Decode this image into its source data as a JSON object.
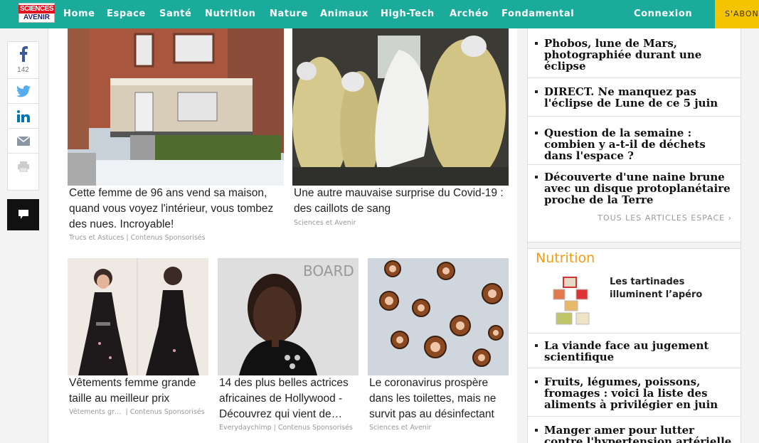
{
  "header": {
    "logo_line1": "SCIENCES",
    "logo_line2": "AVENIR",
    "nav": [
      "Home",
      "Espace",
      "Santé",
      "Nutrition",
      "Nature",
      "Animaux",
      "High-Tech",
      "Archéo",
      "Fondamental"
    ],
    "login": "Connexion",
    "subscribe": "S'ABONNER"
  },
  "share": {
    "facebook_count": "142",
    "icons": [
      "facebook-icon",
      "twitter-icon",
      "linkedin-icon",
      "email-icon",
      "print-icon"
    ],
    "comment_icon": "comment-icon"
  },
  "cards": [
    {
      "title": "Cette femme de 96 ans vend sa maison, quand vous voyez l'intérieur, vous tombez des nues. Incroyable!",
      "source": "Trucs et Astuces",
      "sponsored": "Contenus Sponsorisés"
    },
    {
      "title": "Une autre mauvaise surprise du Covid-19 : des caillots de sang",
      "source": "Sciences et Avenir",
      "sponsored": ""
    },
    {
      "title": "Vêtements femme grande taille au meilleur prix",
      "source": "Vêtements gr…",
      "sponsored": "Contenus Sponsorisés"
    },
    {
      "title": "14 des plus belles actrices africaines de Hollywood - Découvrez qui vient de…",
      "source": "Everydaychimp",
      "sponsored": "Contenus Sponsorisés"
    },
    {
      "title": "Le coronavirus prospère dans les toilettes, mais ne survit pas au désinfectant",
      "source": "Sciences et Avenir",
      "sponsored": ""
    }
  ],
  "sidebar": {
    "espace_articles": [
      "Phobos, lune de Mars, photographiée durant une éclipse",
      "DIRECT. Ne manquez pas l'éclipse de Lune de ce 5 juin",
      "Question de la semaine : combien y a-t-il de déchets dans l'espace ?",
      "Découverte d'une naine brune avec un disque protoplanétaire proche de la Terre"
    ],
    "all_espace": "TOUS LES ARTICLES ESPACE",
    "nutrition_heading": "Nutrition",
    "nutrition_feature": "Les tartinades illuminent l’apéro",
    "nutrition_articles": [
      "La viande face au jugement scientifique",
      "Fruits, légumes, poissons, fromages : voici la liste des aliments à privilégier en juin",
      "Manger amer pour lutter contre l'hypertension artérielle ?"
    ]
  },
  "colors": {
    "nav_bg": "#1aab9b",
    "subscribe_bg": "#f5c400",
    "nutrition": "#f39c12",
    "logo_red": "#e2131e"
  }
}
